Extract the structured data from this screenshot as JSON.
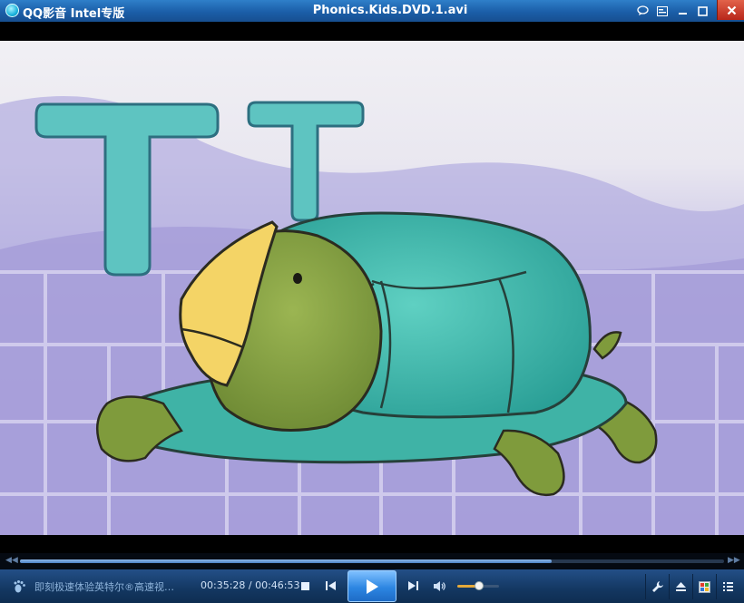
{
  "window": {
    "app_name": "QQ影音  Intel专版",
    "title": "Phonics.Kids.DVD.1.avi"
  },
  "titlebar_buttons": [
    "chat-icon",
    "playlist-icon",
    "minimize-icon",
    "maximize-icon",
    "close-icon"
  ],
  "video": {
    "letters": [
      "T",
      "T"
    ]
  },
  "playback": {
    "progress": 0.755,
    "time_display": "00:35:28 / 00:46:53",
    "promo_text": "即刻极速体验英特尔®高速视…",
    "volume": 0.52
  },
  "colors": {
    "title_bar": "#1b5ea8",
    "control_bar": "#133761",
    "accent": "#2d86e2",
    "volume_fill": "#e5a93a"
  }
}
